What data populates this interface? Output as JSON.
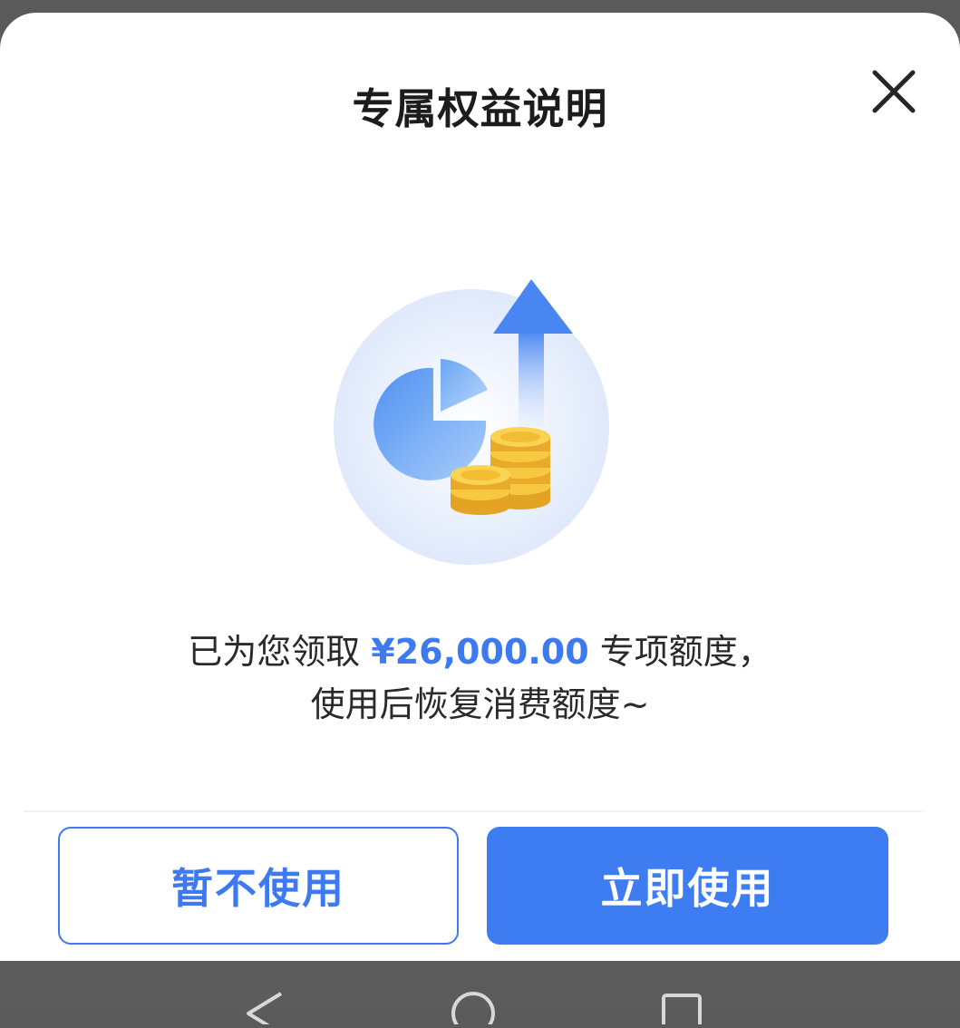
{
  "dialog": {
    "title": "专属权益说明",
    "message_prefix": "已为您领取 ",
    "amount": "¥26,000.00",
    "message_suffix": " 专项额度，",
    "message_line2": "使用后恢复消费额度~",
    "close_icon": "close-icon",
    "illustration_icon": "coins-growth-illustration"
  },
  "actions": {
    "cancel_label": "暂不使用",
    "confirm_label": "立即使用"
  },
  "navbar": {
    "back_icon": "back-triangle-icon",
    "home_icon": "home-circle-icon",
    "recents_icon": "recents-square-icon"
  },
  "colors": {
    "accent": "#3e7cf1",
    "overlay": "#5a5a5a"
  }
}
